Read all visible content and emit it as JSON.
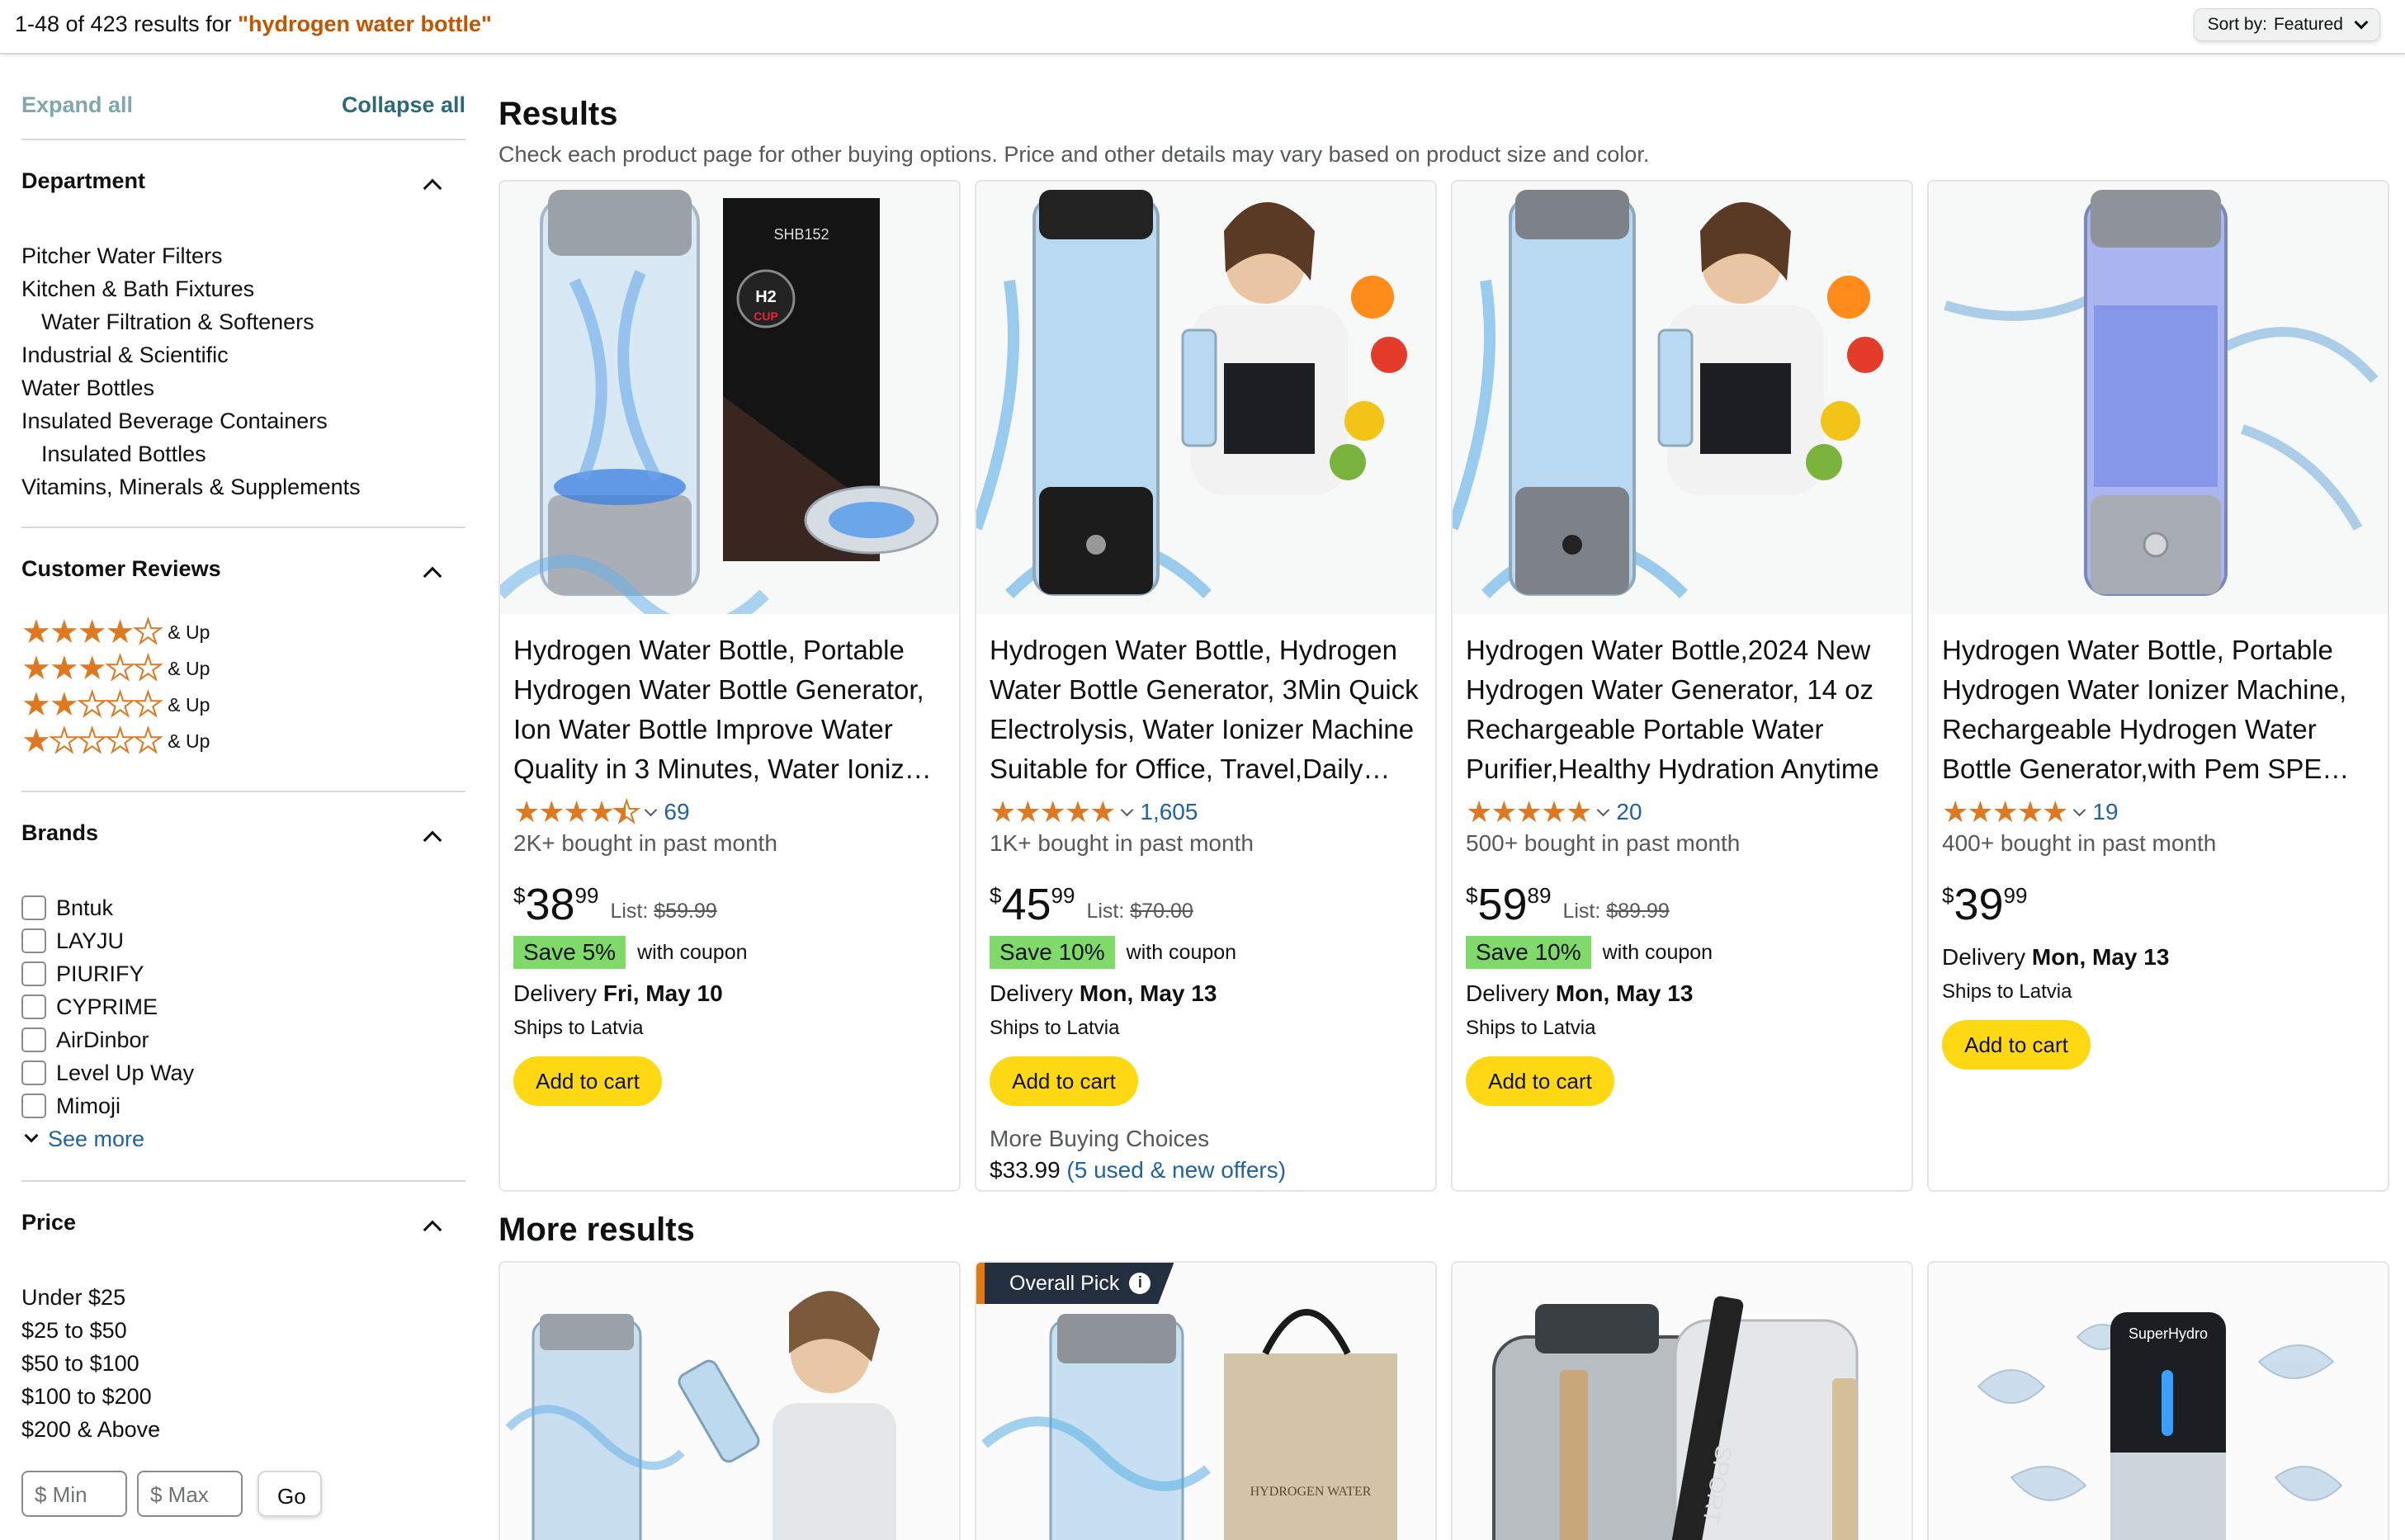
{
  "topbar": {
    "count_prefix": "1-48 of 423 results for ",
    "query": "\"hydrogen water bottle\"",
    "sort_label": "Sort by:",
    "sort_value": "Featured"
  },
  "sidebar": {
    "expand_all": "Expand all",
    "collapse_all": "Collapse all",
    "department": {
      "title": "Department",
      "items": [
        {
          "label": "Pitcher Water Filters",
          "sub": false
        },
        {
          "label": "Kitchen & Bath Fixtures",
          "sub": false
        },
        {
          "label": "Water Filtration & Softeners",
          "sub": true
        },
        {
          "label": "Industrial & Scientific",
          "sub": false
        },
        {
          "label": "Water Bottles",
          "sub": false
        },
        {
          "label": "Insulated Beverage Containers",
          "sub": false
        },
        {
          "label": "Insulated Bottles",
          "sub": true
        },
        {
          "label": "Vitamins, Minerals & Supplements",
          "sub": false
        }
      ]
    },
    "reviews": {
      "title": "Customer Reviews",
      "up_label": "& Up",
      "rows": [
        4,
        3,
        2,
        1
      ]
    },
    "brands": {
      "title": "Brands",
      "items": [
        "Bntuk",
        "LAYJU",
        "PIURIFY",
        "CYPRIME",
        "AirDinbor",
        "Level Up Way",
        "Mimoji"
      ],
      "see_more": "See more"
    },
    "price": {
      "title": "Price",
      "items": [
        "Under $25",
        "$25 to $50",
        "$50 to $100",
        "$100 to $200",
        "$200 & Above"
      ],
      "min_placeholder": "$ Min",
      "max_placeholder": "$ Max",
      "go_label": "Go"
    }
  },
  "results": {
    "heading": "Results",
    "subheading": "Check each product page for other buying options. Price and other details may vary based on product size and color.",
    "add_to_cart": "Add to cart",
    "with_coupon": "with coupon",
    "ships_to": "Ships to Latvia",
    "list_label": "List:",
    "delivery_label": "Delivery",
    "products": [
      {
        "title": "Hydrogen Water Bottle, Portable Hydrogen Water Bottle Generator, Ion Water Bottle Improve Water Quality in 3 Minutes, Water Ionizer for Home",
        "rating": 4.5,
        "rating_count": "69",
        "bought": "2K+ bought in past month",
        "price_whole": "38",
        "price_frac": "99",
        "list_price": "$59.99",
        "save": "Save 5%",
        "delivery_date": "Fri, May 10"
      },
      {
        "title": "Hydrogen Water Bottle, Hydrogen Water Bottle Generator, 3Min Quick Electrolysis, Water Ionizer Machine Suitable for Office, Travel,Daily Drinking",
        "rating": 5,
        "rating_count": "1,605",
        "bought": "1K+ bought in past month",
        "price_whole": "45",
        "price_frac": "99",
        "list_price": "$70.00",
        "save": "Save 10%",
        "delivery_date": "Mon, May 13",
        "more_buying": "More Buying Choices",
        "more_price": "$33.99",
        "more_offers": "(5 used & new offers)"
      },
      {
        "title": "Hydrogen Water Bottle,2024 New Hydrogen Water Generator, 14 oz Rechargeable Portable Water Purifier,Healthy Hydration Anytime",
        "rating": 5,
        "rating_count": "20",
        "bought": "500+ bought in past month",
        "price_whole": "59",
        "price_frac": "89",
        "list_price": "$89.99",
        "save": "Save 10%",
        "delivery_date": "Mon, May 13"
      },
      {
        "title": "Hydrogen Water Bottle, Portable Hydrogen Water Ionizer Machine, Rechargeable Hydrogen Water Bottle Generator,with Pem SPE Technology",
        "rating": 5,
        "rating_count": "19",
        "bought": "400+ bought in past month",
        "price_whole": "39",
        "price_frac": "99",
        "delivery_date": "Mon, May 13"
      }
    ]
  },
  "more_results": {
    "heading": "More results",
    "badge": "Overall Pick",
    "brand_text": "SuperHydro",
    "box_text": "HYDROGEN WATER GENERATOR",
    "strap_text": "SPORT"
  },
  "image_text": {
    "box_model": "SHB152",
    "box_h2": "H2",
    "box_cup": "CUP"
  },
  "colors": {
    "star": "#de7921",
    "link": "#2162a1",
    "query": "#c45500",
    "add_to_cart": "#ffd814",
    "save_badge": "#7fda69"
  }
}
